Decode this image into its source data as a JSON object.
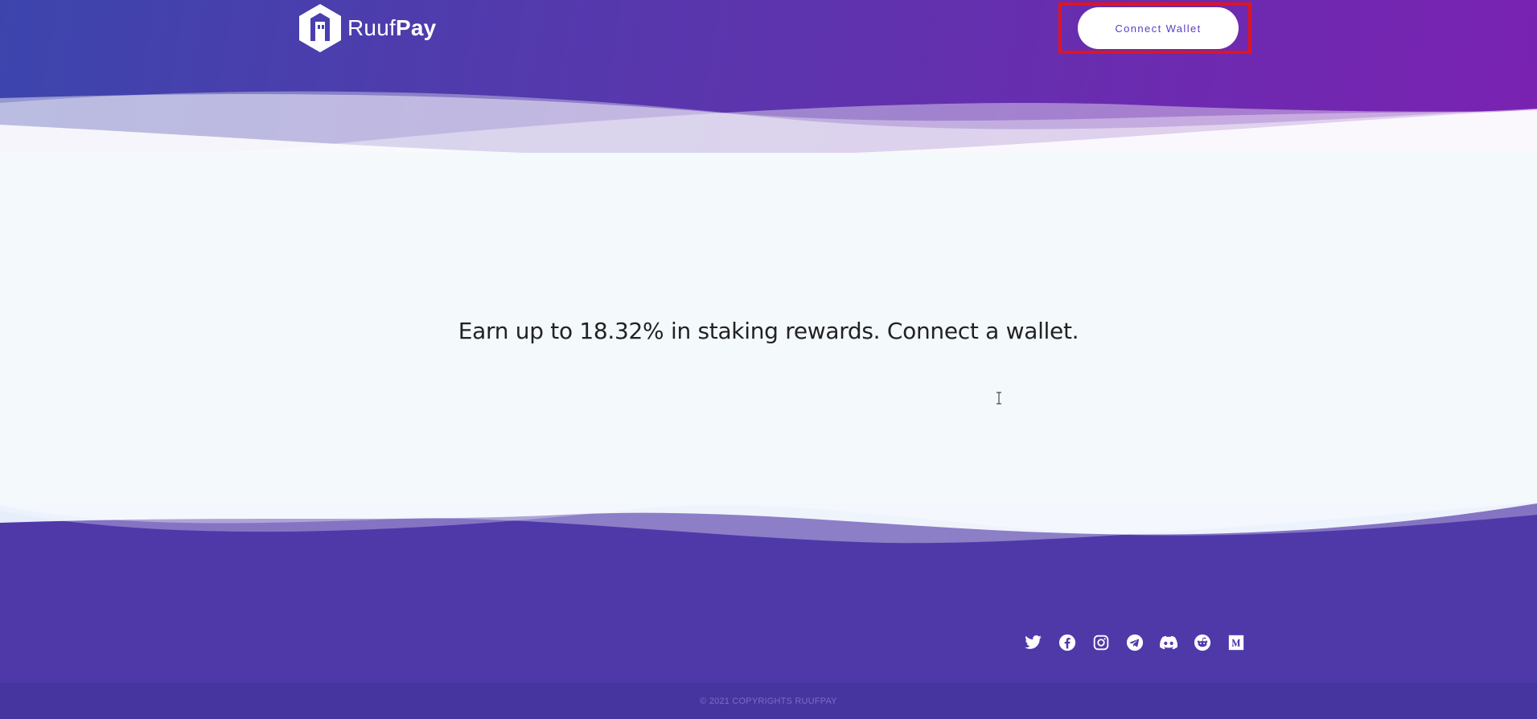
{
  "header": {
    "brand_light": "Ruuf",
    "brand_bold": "Pay",
    "connect_label": "Connect Wallet"
  },
  "main": {
    "headline": "Earn up to 18.32% in staking rewards. Connect a wallet."
  },
  "footer": {
    "social": [
      "twitter-icon",
      "facebook-icon",
      "instagram-icon",
      "telegram-icon",
      "discord-icon",
      "reddit-icon",
      "medium-icon"
    ],
    "copyright": "© 2021 COPYRIGHTS RUUFPAY"
  },
  "colors": {
    "header_gradient_start": "#3d45ad",
    "header_gradient_end": "#7a22b2",
    "footer_bg": "#4f39a9",
    "copyright_bg": "#46359e",
    "connect_text": "#5a3dc4",
    "highlight_border": "#e0141f"
  }
}
